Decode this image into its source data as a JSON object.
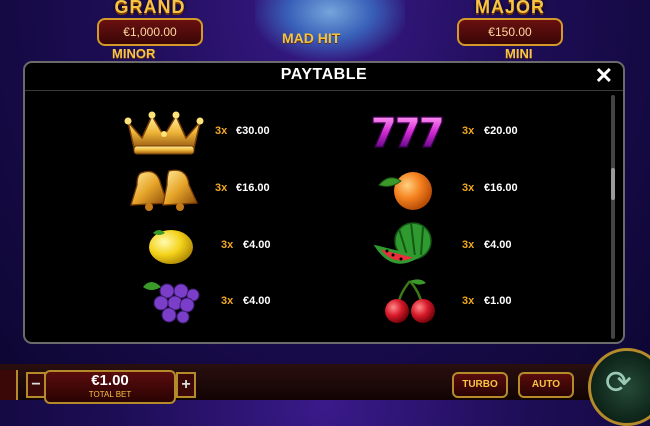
{
  "background": {
    "jackpots": {
      "grand": {
        "label": "GRAND",
        "value": "€1,000.00"
      },
      "major": {
        "label": "MAJOR",
        "value": "€150.00"
      },
      "minor": {
        "label": "MINOR"
      },
      "mini": {
        "label": "MINI"
      }
    },
    "logo_text": "MAD HIT",
    "bet": {
      "value": "€1.00",
      "label": "TOTAL BET",
      "minus": "−",
      "plus": "+"
    },
    "turbo_label": "TURBO",
    "auto_label": "AUTO",
    "spin_icon": "spin-arrows-icon"
  },
  "modal": {
    "title": "PAYTABLE",
    "close_symbol": "✕",
    "rows": [
      {
        "symbol": "crown-icon",
        "multiplier": "3x",
        "amount": "€30.00"
      },
      {
        "symbol": "seven-seven-seven-icon",
        "multiplier": "3x",
        "amount": "€20.00"
      },
      {
        "symbol": "bells-icon",
        "multiplier": "3x",
        "amount": "€16.00"
      },
      {
        "symbol": "orange-icon",
        "multiplier": "3x",
        "amount": "€16.00"
      },
      {
        "symbol": "lemon-icon",
        "multiplier": "3x",
        "amount": "€4.00"
      },
      {
        "symbol": "watermelon-icon",
        "multiplier": "3x",
        "amount": "€4.00"
      },
      {
        "symbol": "grapes-icon",
        "multiplier": "3x",
        "amount": "€4.00"
      },
      {
        "symbol": "cherries-icon",
        "multiplier": "3x",
        "amount": "€1.00"
      }
    ]
  },
  "colors": {
    "multiplier": "#f2a823",
    "gold": "#f7c443",
    "modal_bg": "#000000"
  }
}
